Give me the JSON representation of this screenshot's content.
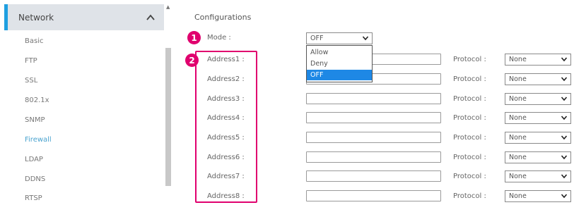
{
  "sidebar": {
    "header": "Network",
    "items": [
      {
        "label": "Basic",
        "active": false
      },
      {
        "label": "FTP",
        "active": false
      },
      {
        "label": "SSL",
        "active": false
      },
      {
        "label": "802.1x",
        "active": false
      },
      {
        "label": "SNMP",
        "active": false
      },
      {
        "label": "Firewall",
        "active": true
      },
      {
        "label": "LDAP",
        "active": false
      },
      {
        "label": "DDNS",
        "active": false
      },
      {
        "label": "RTSP",
        "active": false
      }
    ]
  },
  "main": {
    "title": "Configurations",
    "mode": {
      "badge": "1",
      "label": "Mode :",
      "value": "OFF",
      "options": [
        "Allow",
        "Deny",
        "OFF"
      ],
      "selected_option": "OFF"
    },
    "address_badge": "2",
    "protocol_label": "Protocol :",
    "addresses": [
      {
        "label": "Address1 :",
        "value": "",
        "protocol": "None"
      },
      {
        "label": "Address2 :",
        "value": "",
        "protocol": "None"
      },
      {
        "label": "Address3 :",
        "value": "",
        "protocol": "None"
      },
      {
        "label": "Address4 :",
        "value": "",
        "protocol": "None"
      },
      {
        "label": "Address5 :",
        "value": "",
        "protocol": "None"
      },
      {
        "label": "Address6 :",
        "value": "",
        "protocol": "None"
      },
      {
        "label": "Address7 :",
        "value": "",
        "protocol": "None"
      },
      {
        "label": "Address8 :",
        "value": "",
        "protocol": "None"
      }
    ]
  },
  "colors": {
    "accent": "#1e9fe0",
    "active_nav": "#4aa3cf",
    "highlight": "#e0006e",
    "dropdown_selected": "#1e88e5"
  },
  "icons": {
    "sidebar_collapse": "chevron-up-icon",
    "scroll_up": "scroll-up-arrow-icon",
    "select_arrow": "chevron-down-icon"
  }
}
